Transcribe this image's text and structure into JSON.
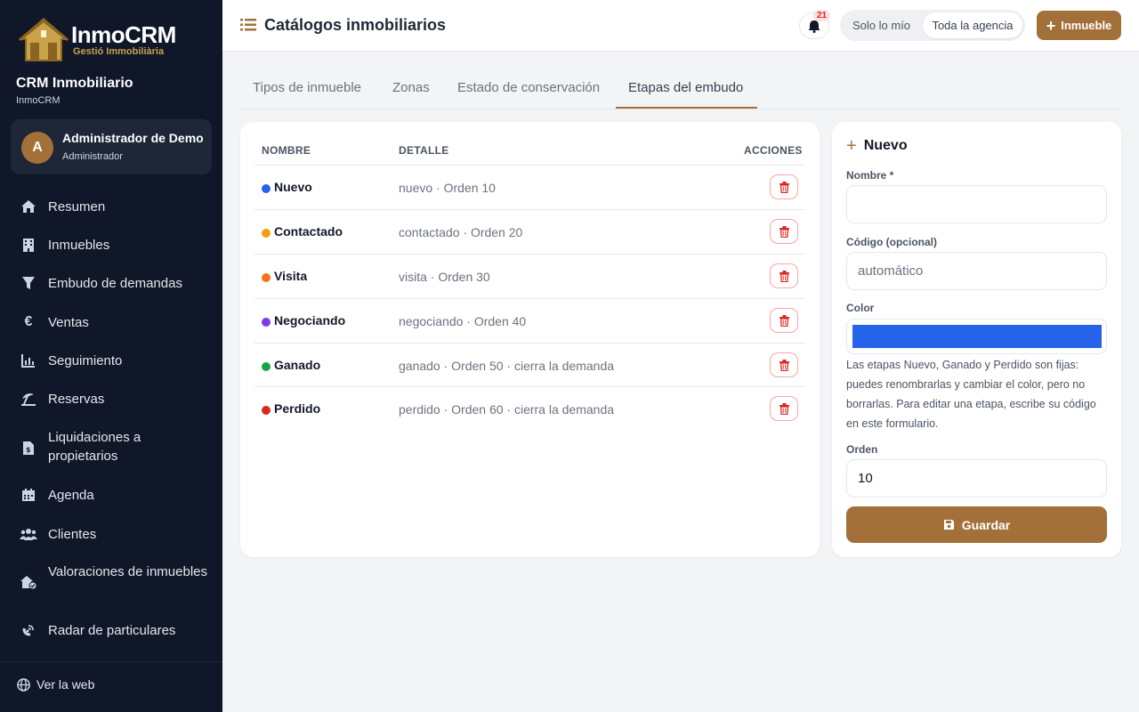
{
  "brand": {
    "logo_title": "InmoCRM",
    "logo_subtitle": "Gestió Immobiliària",
    "app_name": "CRM Inmobiliario",
    "app_subtitle": "InmoCRM",
    "accent_color": "#a3703a"
  },
  "user": {
    "initial": "A",
    "name": "Administrador de Demo",
    "role": "Administrador"
  },
  "sidebar": {
    "items": [
      {
        "label": "Resumen",
        "icon": "home-icon"
      },
      {
        "label": "Inmuebles",
        "icon": "building-icon"
      },
      {
        "label": "Embudo de demandas",
        "icon": "filter-icon"
      },
      {
        "label": "Ventas",
        "icon": "euro-icon"
      },
      {
        "label": "Seguimiento",
        "icon": "chart-icon"
      },
      {
        "label": "Reservas",
        "icon": "umbrella-beach-icon"
      },
      {
        "label": "Liquidaciones a propietarios",
        "icon": "invoice-icon"
      },
      {
        "label": "Agenda",
        "icon": "calendar-icon"
      },
      {
        "label": "Clientes",
        "icon": "users-icon"
      },
      {
        "label": "Valoraciones de inmuebles",
        "icon": "house-check-icon"
      },
      {
        "label": "Radar de particulares",
        "icon": "radar-icon"
      }
    ],
    "web_link": "Ver la web"
  },
  "header": {
    "title": "Catálogos inmobiliarios",
    "notifications_count": "21",
    "scope_mine": "Solo lo mío",
    "scope_agency": "Toda la agencia",
    "new_button": "Inmueble"
  },
  "tabs": [
    {
      "label": "Tipos de inmueble",
      "active": false
    },
    {
      "label": "Zonas",
      "active": false
    },
    {
      "label": "Estado de conservación",
      "active": false
    },
    {
      "label": "Etapas del embudo",
      "active": true
    }
  ],
  "table": {
    "headers": {
      "name": "NOMBRE",
      "detail": "DETALLE",
      "actions": "ACCIONES"
    },
    "rows": [
      {
        "name": "Nuevo",
        "detail": "nuevo · Orden 10",
        "color": "#2563eb"
      },
      {
        "name": "Contactado",
        "detail": "contactado · Orden 20",
        "color": "#f59e0b"
      },
      {
        "name": "Visita",
        "detail": "visita · Orden 30",
        "color": "#f97316"
      },
      {
        "name": "Negociando",
        "detail": "negociando · Orden 40",
        "color": "#7c3aed"
      },
      {
        "name": "Ganado",
        "detail": "ganado · Orden 50 · cierra la demanda",
        "color": "#16a34a"
      },
      {
        "name": "Perdido",
        "detail": "perdido · Orden 60 · cierra la demanda",
        "color": "#dc2626"
      }
    ]
  },
  "form": {
    "title": "Nuevo",
    "name_label": "Nombre *",
    "name_value": "",
    "code_label": "Código (opcional)",
    "code_placeholder": "automático",
    "color_label": "Color",
    "color_value": "#2563eb",
    "help_text": "Las etapas Nuevo, Ganado y Perdido son fijas: puedes renombrarlas y cambiar el color, pero no borrarlas. Para editar una etapa, escribe su código en este formulario.",
    "order_label": "Orden",
    "order_value": "10",
    "save_button": "Guardar"
  }
}
